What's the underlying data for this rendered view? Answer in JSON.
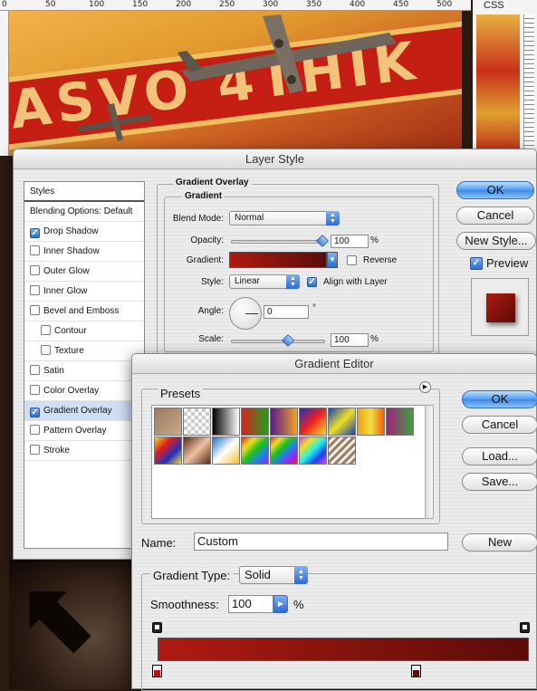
{
  "background": {
    "ruler_ticks": [
      "0",
      "50",
      "100",
      "150",
      "200",
      "250",
      "300",
      "350",
      "400",
      "450",
      "500"
    ],
    "css_tab": "CSS",
    "artwork_text": "ASVO 4THIK"
  },
  "layer_style": {
    "title": "Layer Style",
    "styles_header": "Styles",
    "items": [
      {
        "label": "Blending Options: Default",
        "checkbox": false,
        "checked": false,
        "indent": false,
        "selected": false
      },
      {
        "label": "Drop Shadow",
        "checkbox": true,
        "checked": true,
        "indent": false,
        "selected": false
      },
      {
        "label": "Inner Shadow",
        "checkbox": true,
        "checked": false,
        "indent": false,
        "selected": false
      },
      {
        "label": "Outer Glow",
        "checkbox": true,
        "checked": false,
        "indent": false,
        "selected": false
      },
      {
        "label": "Inner Glow",
        "checkbox": true,
        "checked": false,
        "indent": false,
        "selected": false
      },
      {
        "label": "Bevel and Emboss",
        "checkbox": true,
        "checked": false,
        "indent": false,
        "selected": false
      },
      {
        "label": "Contour",
        "checkbox": true,
        "checked": false,
        "indent": true,
        "selected": false
      },
      {
        "label": "Texture",
        "checkbox": true,
        "checked": false,
        "indent": true,
        "selected": false
      },
      {
        "label": "Satin",
        "checkbox": true,
        "checked": false,
        "indent": false,
        "selected": false
      },
      {
        "label": "Color Overlay",
        "checkbox": true,
        "checked": false,
        "indent": false,
        "selected": false
      },
      {
        "label": "Gradient Overlay",
        "checkbox": true,
        "checked": true,
        "indent": false,
        "selected": true
      },
      {
        "label": "Pattern Overlay",
        "checkbox": true,
        "checked": false,
        "indent": false,
        "selected": false
      },
      {
        "label": "Stroke",
        "checkbox": true,
        "checked": false,
        "indent": false,
        "selected": false
      }
    ],
    "section_title": "Gradient Overlay",
    "subsection_title": "Gradient",
    "blend_mode_label": "Blend Mode:",
    "blend_mode_value": "Normal",
    "opacity_label": "Opacity:",
    "opacity_value": "100",
    "opacity_unit": "%",
    "opacity_level": 1.0,
    "gradient_label": "Gradient:",
    "reverse_label": "Reverse",
    "style_label": "Style:",
    "style_value": "Linear",
    "align_label": "Align with Layer",
    "angle_label": "Angle:",
    "angle_value": "0",
    "angle_unit": "°",
    "scale_label": "Scale:",
    "scale_value": "100",
    "scale_unit": "%",
    "scale_level": 0.5,
    "buttons": {
      "ok": "OK",
      "cancel": "Cancel",
      "new_style": "New Style..."
    },
    "preview_label": "Preview",
    "gradient_colors": [
      "#b01a12",
      "#5a0c08"
    ]
  },
  "gradient_editor": {
    "title": "Gradient Editor",
    "presets_label": "Presets",
    "buttons": {
      "ok": "OK",
      "cancel": "Cancel",
      "load": "Load...",
      "save": "Save...",
      "new": "New"
    },
    "name_label": "Name:",
    "name_value": "Custom",
    "gradient_type_label": "Gradient Type:",
    "gradient_type_value": "Solid",
    "smoothness_label": "Smoothness:",
    "smoothness_value": "100",
    "smoothness_unit": "%",
    "presets": [
      "linear-gradient(135deg,#9b7a60,#c9a98a)",
      "repeating-conic-gradient(#ccc 0 25%, #fff 0 50%) 0 0/8px 8px",
      "linear-gradient(90deg,#000,#fff)",
      "linear-gradient(90deg,#e02020,#20a020)",
      "linear-gradient(90deg,#5a1a90,#f0a020)",
      "linear-gradient(135deg,#2030c0,#f02020,#f0e020)",
      "linear-gradient(135deg,#1040c0,#f0e020,#1040c0)",
      "linear-gradient(90deg,#f0a010,#f0e040,#f06010)",
      "linear-gradient(90deg,#a02080,#40a040)",
      "linear-gradient(135deg,#f0e020,#e02020,#2030c0,#f0e020)",
      "linear-gradient(135deg,#5a2a1a,#f0c0a0,#5a2a1a)",
      "linear-gradient(135deg,#2070c0,#ffffff,#f0c020)",
      "linear-gradient(135deg,#f02020,#f0e020,#20c020,#2080f0,#a020f0)",
      "linear-gradient(135deg,#f02020,#f0e020,#20c020,#2080f0,#a020f0,#f02020)",
      "linear-gradient(135deg,#f040f0,#f0e020,#20f0f0,#2040f0,#f040f0)",
      "repeating-linear-gradient(135deg,#a08060 0 3px,#f0f0f0 3px 6px)"
    ],
    "stop_colors": [
      "#b01a12",
      "#5a0c08"
    ]
  }
}
